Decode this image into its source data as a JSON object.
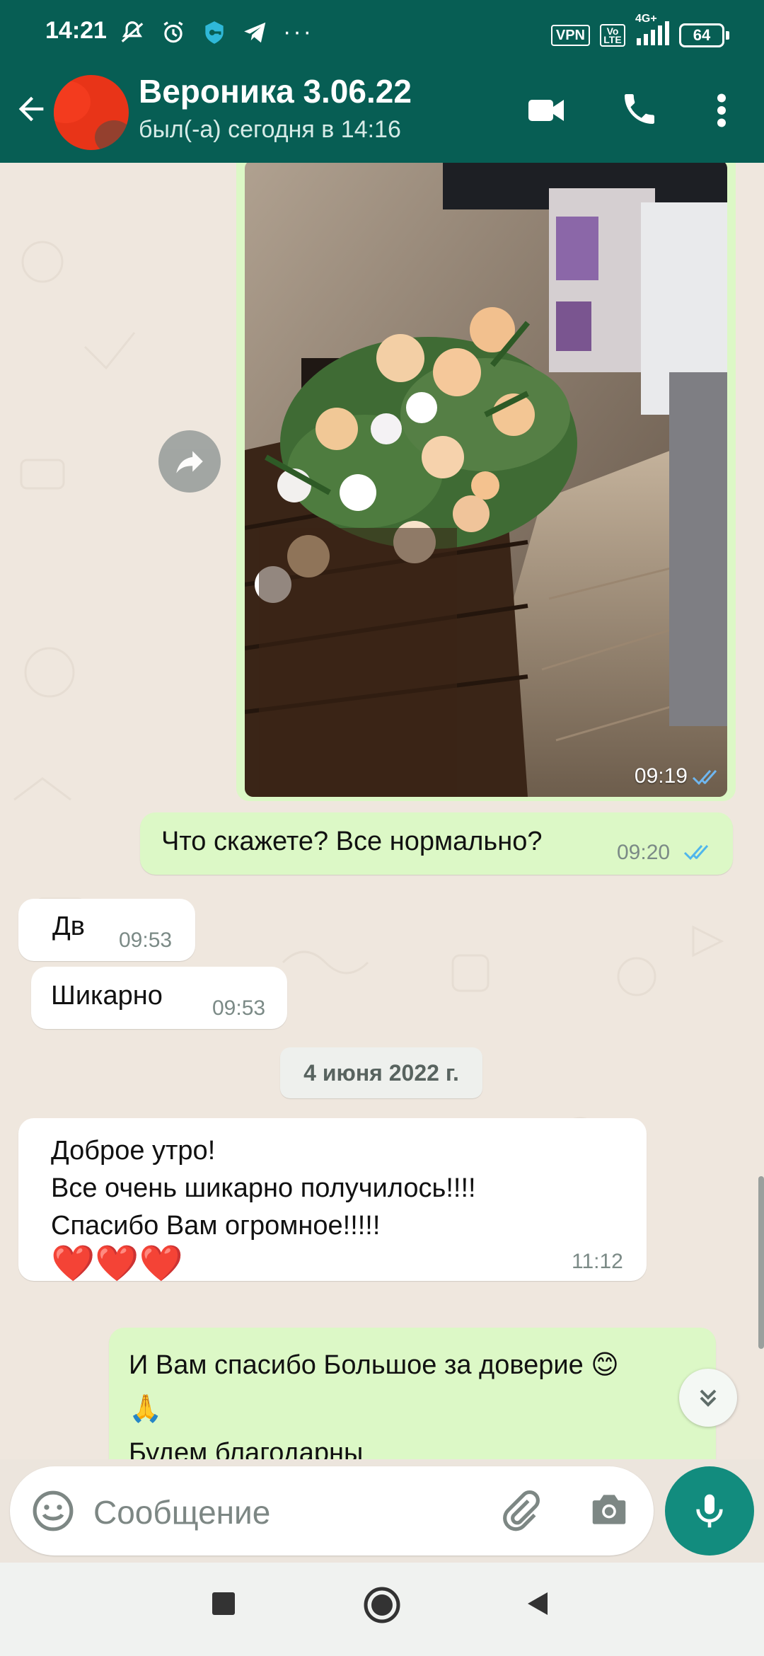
{
  "statusbar": {
    "time": "14:21",
    "vpn": "VPN",
    "volte": "Vo LTE",
    "network": "4G+",
    "battery": "64"
  },
  "header": {
    "name": "Вероника 3.06.22",
    "status": "был(-а) сегодня в 14:16"
  },
  "messages": {
    "image": {
      "time": "09:19"
    },
    "m1": {
      "text": "Что скажете? Все нормально?",
      "time": "09:20"
    },
    "m2": {
      "text": "Дв",
      "time": "09:53"
    },
    "m3": {
      "text": "Шикарно",
      "time": "09:53"
    },
    "date": "4 июня 2022 г.",
    "m4": {
      "line1": "Доброе утро!",
      "line2": "Все очень шикарно получилось!!!!",
      "line3": "Спасибо Вам огромное!!!!!",
      "emoji": "❤️❤️❤️",
      "time": "11:12"
    },
    "m5": {
      "line1": "И Вам спасибо Большое за доверие 😊",
      "line2": "🙏",
      "line3": "Будем благодарны"
    }
  },
  "composer": {
    "placeholder": "Сообщение"
  },
  "colors": {
    "header": "#075e54",
    "accent": "#128c7e",
    "outgoing": "#dcf8c6",
    "tick": "#4fb6ec"
  }
}
